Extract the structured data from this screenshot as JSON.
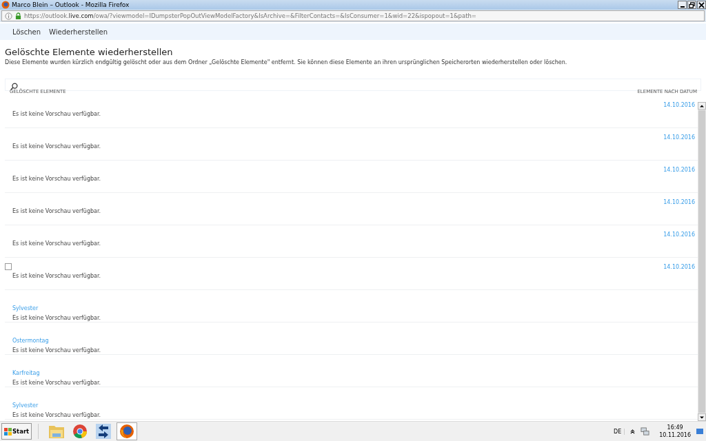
{
  "window": {
    "title": "Marco Blein – Outlook - Mozilla Firefox"
  },
  "address_bar": {
    "url_prefix": "https://outlook.",
    "url_domain": "live.com",
    "url_rest": "/owa/?viewmodel=IDumpsterPopOutViewModelFactory&IsArchive=&FilterContacts=&IsConsumer=1&wid=22&ispopout=1&path="
  },
  "toolbar": [
    "Löschen",
    "Wiederherstellen"
  ],
  "heading": "Gelöschte Elemente wiederherstellen",
  "description": "Diese Elemente wurden kürzlich endgültig gelöscht oder aus dem Ordner „Gelöschte Elemente\" entfernt. Sie können diese Elemente an ihren ursprünglichen Speicherorten wiederherstellen oder löschen.",
  "list_header": {
    "left": "GELÖSCHTE ELEMENTE",
    "right": "ELEMENTE NACH DATUM"
  },
  "items": [
    {
      "date": "14.10.2016",
      "preview": "Es ist keine Vorschau verfügbar."
    },
    {
      "date": "14.10.2016",
      "preview": "Es ist keine Vorschau verfügbar."
    },
    {
      "date": "14.10.2016",
      "preview": "Es ist keine Vorschau verfügbar."
    },
    {
      "date": "14.10.2016",
      "preview": "Es ist keine Vorschau verfügbar."
    },
    {
      "date": "14.10.2016",
      "preview": "Es ist keine Vorschau verfügbar."
    },
    {
      "date": "14.10.2016",
      "preview": "Es ist keine Vorschau verfügbar.",
      "checked": false
    },
    {
      "title": "Sylvester",
      "preview": "Es ist keine Vorschau verfügbar."
    },
    {
      "title": "Ostermontag",
      "preview": "Es ist keine Vorschau verfügbar."
    },
    {
      "title": "Karfreitag",
      "preview": "Es ist keine Vorschau verfügbar."
    },
    {
      "title": "Sylvester",
      "preview": "Es ist keine Vorschau verfügbar."
    }
  ],
  "taskbar": {
    "start": "Start",
    "apps": [
      {
        "kind": "folder",
        "selected": false
      },
      {
        "kind": "chrome",
        "selected": false
      },
      {
        "kind": "sync",
        "selected": false
      },
      {
        "kind": "firefox",
        "selected": true
      }
    ],
    "language": "DE",
    "time": "16:49",
    "date": "10.11.2016"
  }
}
